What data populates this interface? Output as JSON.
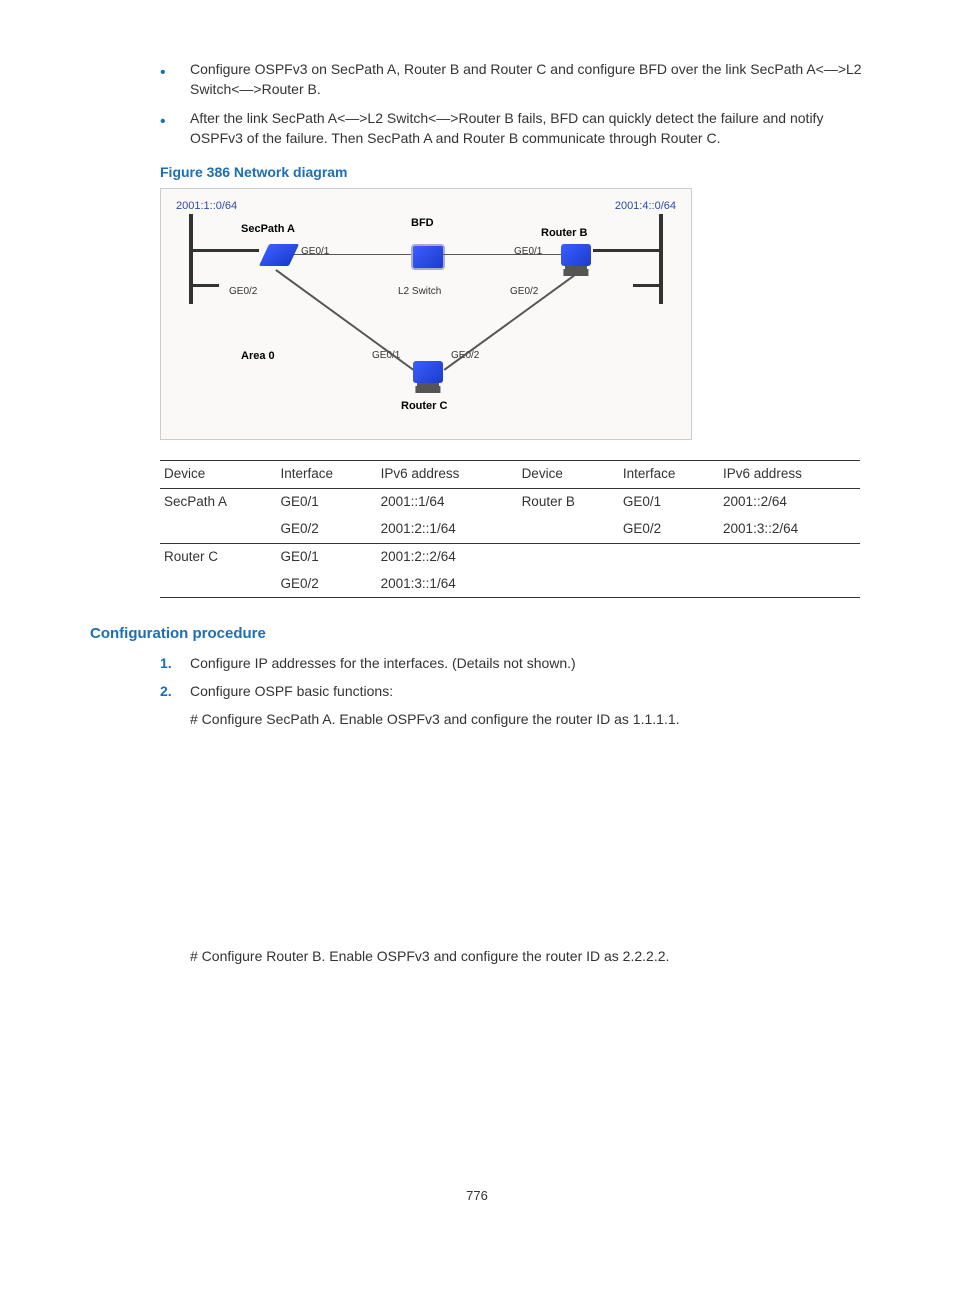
{
  "bullets": [
    "Configure OSPFv3 on SecPath A, Router B and Router C and configure BFD over the link SecPath A<—>L2 Switch<—>Router B.",
    "After the link SecPath A<—>L2 Switch<—>Router B fails, BFD can quickly detect the failure and notify OSPFv3 of the failure. Then SecPath A and Router B communicate through Router C."
  ],
  "figure_caption": "Figure 386 Network diagram",
  "diagram": {
    "net_left": "2001:1::0/64",
    "net_right": "2001:4::0/64",
    "secpath": "SecPath A",
    "bfd": "BFD",
    "routerB": "Router B",
    "routerC": "Router C",
    "l2switch": "L2 Switch",
    "area": "Area 0",
    "ge01": "GE0/1",
    "ge02": "GE0/2"
  },
  "table": {
    "h_device": "Device",
    "h_interface": "Interface",
    "h_addr": "IPv6 address",
    "rows": [
      {
        "d1": "SecPath A",
        "i1": "GE0/1",
        "a1": "2001::1/64",
        "d2": "Router B",
        "i2": "GE0/1",
        "a2": "2001::2/64"
      },
      {
        "d1": "",
        "i1": "GE0/2",
        "a1": "2001:2::1/64",
        "d2": "",
        "i2": "GE0/2",
        "a2": "2001:3::2/64"
      },
      {
        "d1": "Router C",
        "i1": "GE0/1",
        "a1": "2001:2::2/64",
        "d2": "",
        "i2": "",
        "a2": ""
      },
      {
        "d1": "",
        "i1": "GE0/2",
        "a1": "2001:3::1/64",
        "d2": "",
        "i2": "",
        "a2": ""
      }
    ]
  },
  "section_heading": "Configuration procedure",
  "steps": {
    "s1_num": "1.",
    "s1_text": "Configure IP addresses for the interfaces. (Details not shown.)",
    "s2_num": "2.",
    "s2_text": "Configure OSPF basic functions:",
    "s2_sub": "# Configure SecPath A. Enable OSPFv3 and configure the router ID as 1.1.1.1.",
    "s2_after": "# Configure Router B. Enable OSPFv3 and configure the router ID as 2.2.2.2."
  },
  "page_number": "776"
}
